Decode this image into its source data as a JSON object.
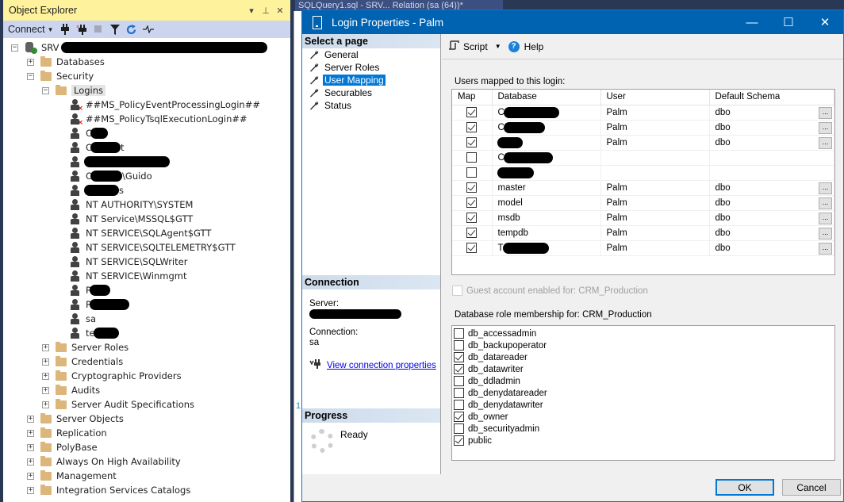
{
  "object_explorer": {
    "title": "Object Explorer",
    "title_controls": {
      "dropdown": "▾",
      "pin": "⊥",
      "close": "✕"
    },
    "toolbar": {
      "connect_label": "Connect",
      "buttons": [
        "connect-icon",
        "disconnect-icon",
        "stop-icon",
        "filter-icon",
        "refresh-icon",
        "activity-monitor-icon"
      ]
    },
    "tree": {
      "server": {
        "label": "SRV",
        "redacted": true
      },
      "nodes": [
        {
          "label": "Databases",
          "expander": "+"
        },
        {
          "label": "Security",
          "expander": "−"
        },
        {
          "label": "Logins",
          "expander": "−"
        },
        {
          "label": "##MS_PolicyEventProcessingLogin##",
          "disabled": true
        },
        {
          "label": "##MS_PolicyTsqlExecutionLogin##",
          "disabled": true
        },
        {
          "label": "C",
          "redacted": true
        },
        {
          "label": "C",
          "suffix": "t",
          "redacted": true
        },
        {
          "label": "",
          "redacted": true
        },
        {
          "label": "C",
          "suffix": "\\Guido",
          "redacted": true
        },
        {
          "label": "",
          "suffix": "s",
          "redacted": true
        },
        {
          "label": "NT AUTHORITY\\SYSTEM"
        },
        {
          "label": "NT Service\\MSSQL$GTT"
        },
        {
          "label": "NT SERVICE\\SQLAgent$GTT"
        },
        {
          "label": "NT SERVICE\\SQLTELEMETRY$GTT"
        },
        {
          "label": "NT SERVICE\\SQLWriter"
        },
        {
          "label": "NT SERVICE\\Winmgmt"
        },
        {
          "label": "P",
          "redacted": true
        },
        {
          "label": "P",
          "redacted": true
        },
        {
          "label": "sa"
        },
        {
          "label": "te",
          "redacted": true
        },
        {
          "label": "Server Roles",
          "expander": "+"
        },
        {
          "label": "Credentials",
          "expander": "+"
        },
        {
          "label": "Cryptographic Providers",
          "expander": "+"
        },
        {
          "label": "Audits",
          "expander": "+"
        },
        {
          "label": "Server Audit Specifications",
          "expander": "+"
        },
        {
          "label": "Server Objects",
          "expander": "+"
        },
        {
          "label": "Replication",
          "expander": "+"
        },
        {
          "label": "PolyBase",
          "expander": "+"
        },
        {
          "label": "Always On High Availability",
          "expander": "+"
        },
        {
          "label": "Management",
          "expander": "+"
        },
        {
          "label": "Integration Services Catalogs",
          "expander": "+"
        }
      ]
    }
  },
  "background_tab": {
    "label": "SQLQuery1.sql - SRV... Relation (sa (64))*",
    "line_number": "1"
  },
  "dialog": {
    "title": "Login Properties - Palm",
    "window_buttons": {
      "minimize": "—",
      "maximize": "☐",
      "close": "✕"
    },
    "select_page": {
      "header": "Select a page",
      "pages": [
        {
          "label": "General",
          "active": false
        },
        {
          "label": "Server Roles",
          "active": false
        },
        {
          "label": "User Mapping",
          "active": true
        },
        {
          "label": "Securables",
          "active": false
        },
        {
          "label": "Status",
          "active": false
        }
      ]
    },
    "connection": {
      "header": "Connection",
      "server_label": "Server:",
      "server_value_redacted": true,
      "connection_label": "Connection:",
      "connection_value": "sa",
      "link": "View connection properties"
    },
    "progress": {
      "header": "Progress",
      "status": "Ready"
    },
    "toolbar": {
      "script": "Script",
      "help": "Help"
    },
    "users_mapped": {
      "label": "Users mapped to this login:",
      "columns": [
        "Map",
        "Database",
        "User",
        "Default Schema"
      ],
      "rows": [
        {
          "map": true,
          "database": "C",
          "redacted": true,
          "user": "Palm",
          "schema": "dbo",
          "ellipsis": true
        },
        {
          "map": true,
          "database": "C",
          "redacted": true,
          "user": "Palm",
          "schema": "dbo",
          "ellipsis": true
        },
        {
          "map": true,
          "database": "",
          "redacted": true,
          "user": "Palm",
          "schema": "dbo",
          "ellipsis": true
        },
        {
          "map": false,
          "database": "C",
          "redacted": true,
          "user": "",
          "schema": "",
          "ellipsis": false
        },
        {
          "map": false,
          "database": "",
          "redacted": true,
          "user": "",
          "schema": "",
          "ellipsis": false
        },
        {
          "map": true,
          "database": "master",
          "user": "Palm",
          "schema": "dbo",
          "ellipsis": true
        },
        {
          "map": true,
          "database": "model",
          "user": "Palm",
          "schema": "dbo",
          "ellipsis": true
        },
        {
          "map": true,
          "database": "msdb",
          "user": "Palm",
          "schema": "dbo",
          "ellipsis": true
        },
        {
          "map": true,
          "database": "tempdb",
          "user": "Palm",
          "schema": "dbo",
          "ellipsis": true
        },
        {
          "map": true,
          "database": "T",
          "redacted": true,
          "user": "Palm",
          "schema": "dbo",
          "ellipsis": true
        }
      ],
      "ellipsis_label": "..."
    },
    "guest": {
      "label": "Guest account enabled for: CRM_Production",
      "checked": false,
      "enabled": false
    },
    "roles": {
      "label": "Database role membership for: CRM_Production",
      "items": [
        {
          "label": "db_accessadmin",
          "checked": false
        },
        {
          "label": "db_backupoperator",
          "checked": false
        },
        {
          "label": "db_datareader",
          "checked": true
        },
        {
          "label": "db_datawriter",
          "checked": true
        },
        {
          "label": "db_ddladmin",
          "checked": false
        },
        {
          "label": "db_denydatareader",
          "checked": false
        },
        {
          "label": "db_denydatawriter",
          "checked": false
        },
        {
          "label": "db_owner",
          "checked": true
        },
        {
          "label": "db_securityadmin",
          "checked": false
        },
        {
          "label": "public",
          "checked": true
        }
      ]
    },
    "buttons": {
      "ok": "OK",
      "cancel": "Cancel"
    }
  }
}
